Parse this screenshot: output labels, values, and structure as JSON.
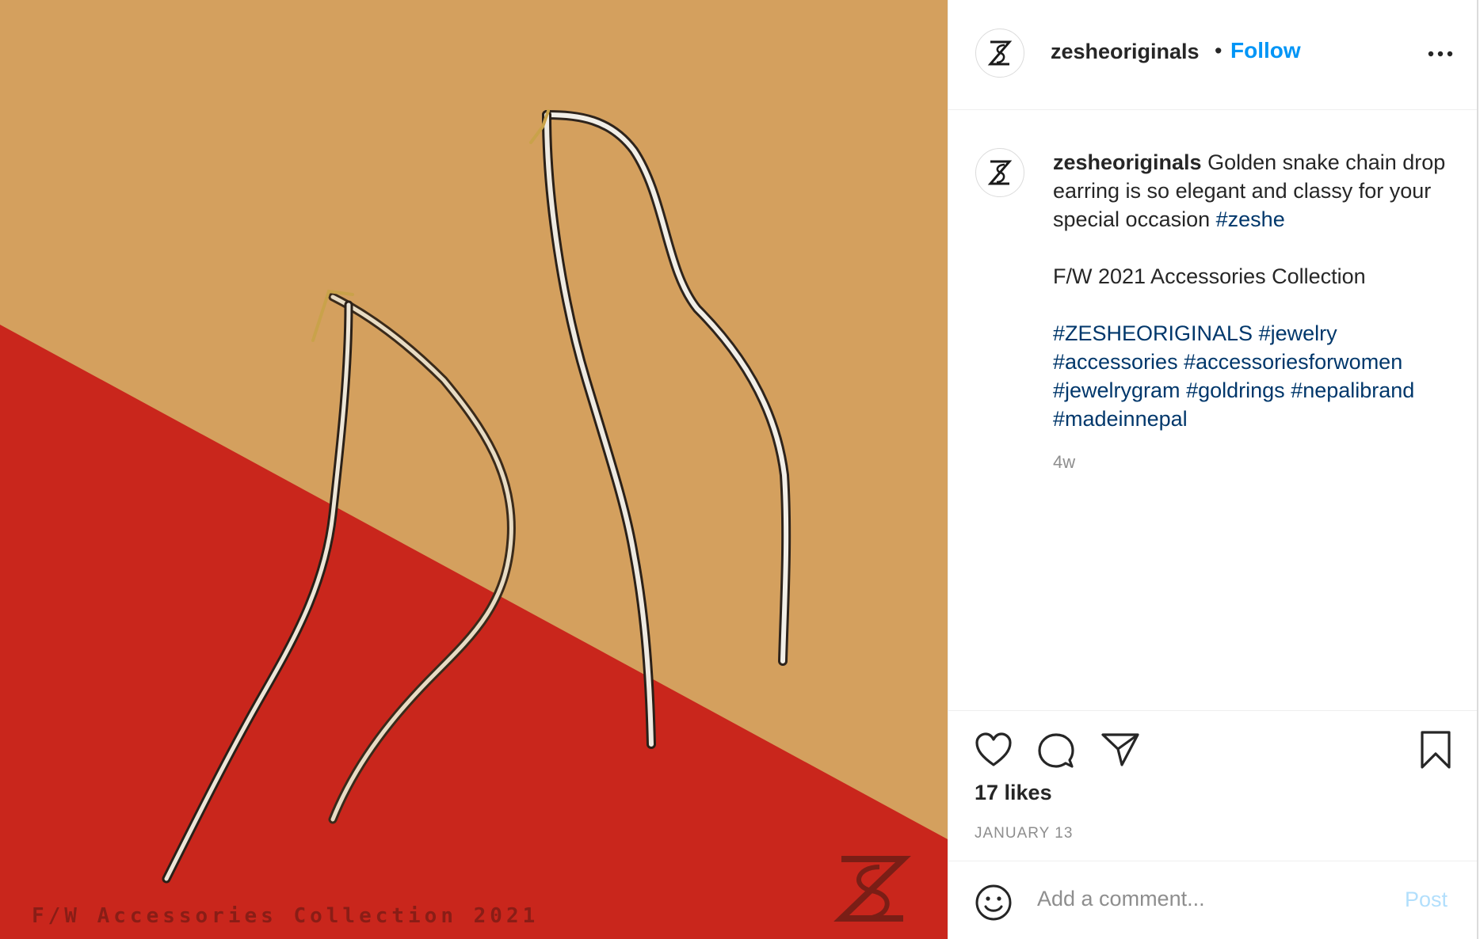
{
  "photo": {
    "watermark_text": "F/W Accessories Collection 2021",
    "logo_text": "ZS",
    "colors": {
      "tan": "#d4a05e",
      "red": "#c9261c"
    }
  },
  "header": {
    "username": "zesheoriginals",
    "separator": "•",
    "follow_label": "Follow",
    "more_icon": "more-options-icon"
  },
  "caption": {
    "username": "zesheoriginals",
    "text": "Golden snake chain drop earring is so elegant and classy for your special occasion",
    "inline_tag": "#zeshe",
    "collection_line": "F/W 2021 Accessories Collection",
    "hashtags_line1": [
      "#ZESHEORIGINALS",
      "#jewelry"
    ],
    "hashtags_line2": [
      "#accessories",
      "#accessoriesforwomen"
    ],
    "hashtags_line3": [
      "#jewelrygram",
      "#goldrings",
      "#nepalibrand"
    ],
    "hashtags_line4": [
      "#madeinnepal"
    ],
    "time_ago": "4w"
  },
  "actions": {
    "icons": [
      "heart-icon",
      "comment-icon",
      "share-icon",
      "bookmark-icon"
    ],
    "likes": "17 likes",
    "date": "JANUARY 13"
  },
  "comment": {
    "placeholder": "Add a comment...",
    "post_label": "Post",
    "emoji_icon": "emoji-icon"
  },
  "colors": {
    "follow": "#0095f6",
    "hashtag": "#00376b",
    "muted": "#8e8e8e",
    "post_disabled": "#b2dffc"
  }
}
